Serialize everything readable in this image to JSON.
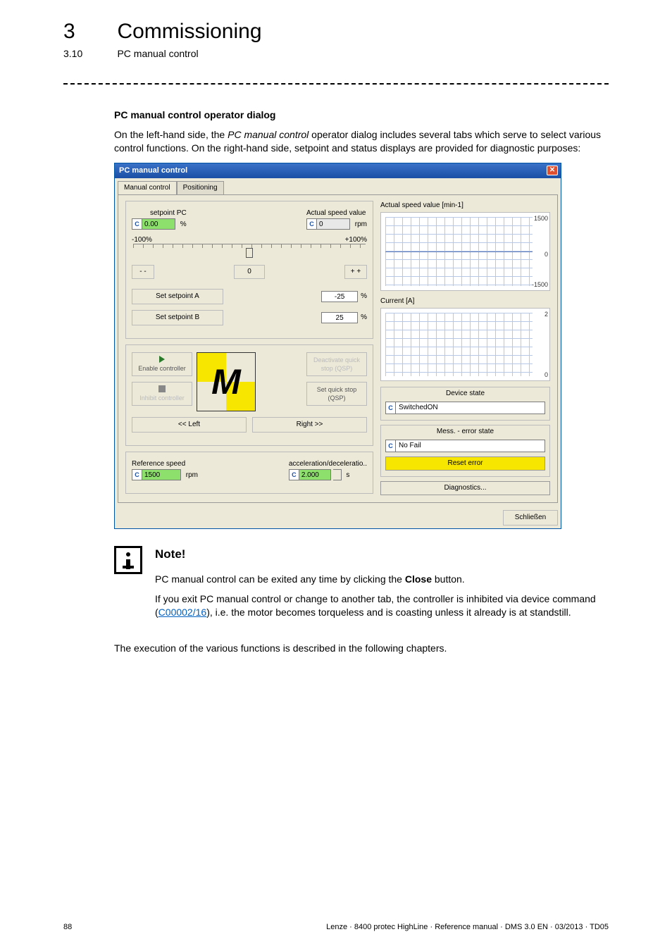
{
  "chapter": {
    "num": "3",
    "title": "Commissioning"
  },
  "section": {
    "num": "3.10",
    "title": "PC manual control"
  },
  "heading": "PC manual control operator dialog",
  "intro_a": "On the left-hand side, the ",
  "intro_em": "PC manual control",
  "intro_b": " operator dialog includes several tabs which serve to select various control functions. On the right-hand side, setpoint and status displays are provided for diagnostic purposes:",
  "dialog": {
    "title": "PC manual control",
    "close": "✕",
    "tabs": {
      "manual": "Manual control",
      "positioning": "Positioning"
    },
    "setpoint": {
      "setpointPC_label": "setpoint PC",
      "setpointPC_value": "0.00",
      "setpointPC_unit": "%",
      "actual_label": "Actual speed value",
      "actual_value": "0",
      "actual_unit": "rpm",
      "minus100": "-100%",
      "plus100": "+100%",
      "mm": "- -",
      "zero": "0",
      "pp": "+ +",
      "setA_label": "Set setpoint A",
      "setA_value": "-25",
      "setA_unit": "%",
      "setB_label": "Set setpoint B",
      "setB_value": "25",
      "setB_unit": "%"
    },
    "controls": {
      "enable": "Enable controller",
      "inhibit": "Inhibit controller",
      "deact_qsp": "Deactivate quick stop (QSP)",
      "set_qsp": "Set quick stop (QSP)",
      "left": "<<  Left",
      "right": "Right  >>"
    },
    "params": {
      "refspeed_label": "Reference speed",
      "refspeed_value": "1500",
      "refspeed_unit": "rpm",
      "accel_label": "acceleration/deceleratio..",
      "accel_value": "2.000",
      "accel_unit": "s"
    },
    "charts": {
      "speed_title": "Actual speed value [min-1]",
      "speed_y_top": "1500",
      "speed_y_mid": "0",
      "speed_y_bot": "-1500",
      "current_title": "Current [A]",
      "current_y_top": "2",
      "current_y_bot": "0"
    },
    "status": {
      "device_cap": "Device state",
      "device_val": "SwitchedON",
      "error_cap": "Mess. - error state",
      "error_val": "No Fail",
      "reset": "Reset error",
      "diag": "Diagnostics..."
    },
    "closeBtn": "Schließen"
  },
  "note": {
    "heading": "Note!",
    "p1a": "PC manual control can be exited any time by clicking the ",
    "p1bold": "Close",
    "p1b": " button.",
    "p2a": "If you exit PC manual control or change to another tab, the controller is inhibited via device command (",
    "p2link": "C00002/16",
    "p2b": "), i.e. the motor becomes torqueless and is coasting unless it already is at standstill."
  },
  "afterNote": "The execution of the various functions is described in the following chapters.",
  "footer": {
    "page": "88",
    "info": "Lenze · 8400 protec HighLine · Reference manual · DMS 3.0 EN · 03/2013 · TD05"
  }
}
